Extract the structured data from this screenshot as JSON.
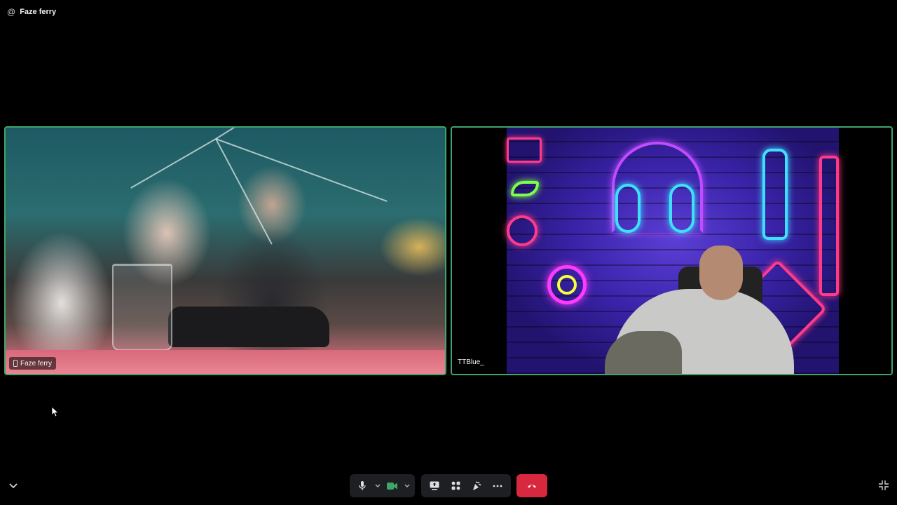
{
  "window": {
    "title": "Faze ferry",
    "at_symbol": "@"
  },
  "participants": [
    {
      "name": "Faze ferry",
      "device": "phone-icon"
    },
    {
      "name": "TTBlue_"
    }
  ],
  "controls": {
    "microphone": "microphone-icon",
    "camera": "camera-icon",
    "screen_share": "screen-share-icon",
    "apps": "apps-icon",
    "soundboard": "soundboard-icon",
    "more": "more-icon",
    "hang_up": "hang-up-icon"
  },
  "colors": {
    "speaking_border": "#3fa56b",
    "hang_up": "#d8283f",
    "camera_active": "#3fa56b",
    "control_bg": "#1e1f22"
  }
}
